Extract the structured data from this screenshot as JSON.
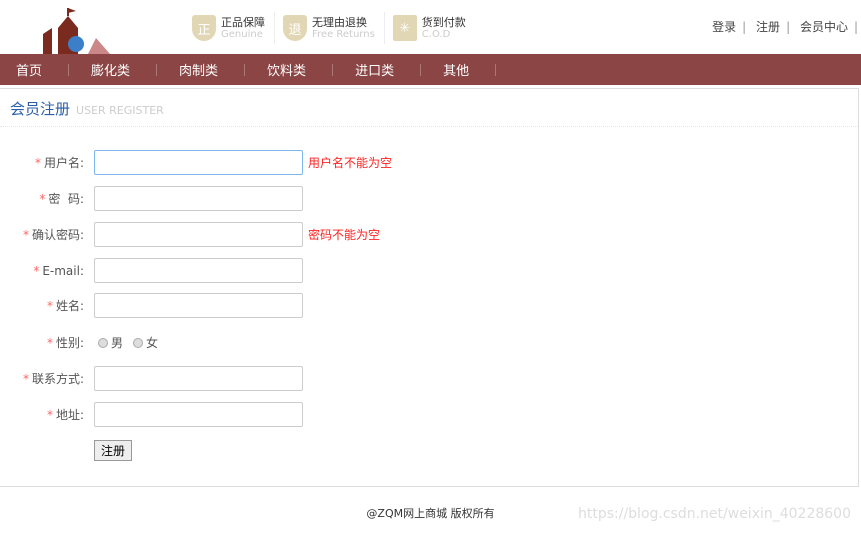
{
  "header": {
    "badges": [
      {
        "icon": "正",
        "title": "正品保障",
        "sub": "Genuine"
      },
      {
        "icon": "退",
        "title": "无理由退换",
        "sub": "Free Returns"
      },
      {
        "icon": "✳",
        "title": "货到付款",
        "sub": "C.O.D"
      }
    ],
    "links": [
      "登录",
      "注册",
      "会员中心"
    ]
  },
  "nav": [
    "首页",
    "膨化类",
    "肉制类",
    "饮料类",
    "进口类",
    "其他"
  ],
  "panel": {
    "title": "会员注册",
    "subtitle": "USER REGISTER"
  },
  "form": {
    "fields": [
      {
        "label": "用户名:",
        "value": "",
        "error": "用户名不能为空"
      },
      {
        "label": "密  码:",
        "value": "",
        "error": ""
      },
      {
        "label": "确认密码:",
        "value": "",
        "error": "密码不能为空"
      },
      {
        "label": "E-mail:",
        "value": "",
        "error": ""
      },
      {
        "label": "姓名:",
        "value": "",
        "error": ""
      }
    ],
    "gender": {
      "label": "性别:",
      "options": [
        "男",
        "女"
      ]
    },
    "fields2": [
      {
        "label": "联系方式:",
        "value": ""
      },
      {
        "label": "地址:",
        "value": ""
      }
    ],
    "required_mark": "*",
    "submit": "注册"
  },
  "footer": "@ZQM网上商城 版权所有",
  "watermark": "https://blog.csdn.net/weixin_40228600",
  "colors": {
    "nav": "#8b4545",
    "title": "#2b5ea8",
    "error": "#ff2222"
  }
}
